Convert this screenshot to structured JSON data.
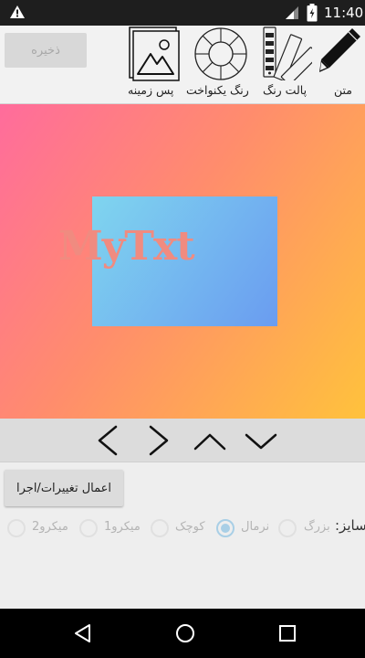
{
  "status_bar": {
    "time": "11:40",
    "icons": [
      "warning-icon",
      "signal-icon",
      "battery-icon"
    ]
  },
  "toolbar": {
    "save_label": "ذخیره",
    "tools": [
      {
        "label": "متن",
        "icon": "pencil-icon"
      },
      {
        "label": "پالت رنگ",
        "icon": "color-palette-icon"
      },
      {
        "label": "رنگ یکنواخت",
        "icon": "color-wheel-icon"
      },
      {
        "label": "پس زمینه",
        "icon": "image-icon"
      }
    ]
  },
  "canvas": {
    "text": "MyTxt",
    "colors": {
      "background_start": "#ff6c9c",
      "background_end": "#ffc23c",
      "rect_start": "#7fd5ef",
      "rect_end": "#6a9cf0",
      "text_color": "#f08b80"
    }
  },
  "arrows": [
    "arrow-left-icon",
    "arrow-right-icon",
    "arrow-up-icon",
    "arrow-down-icon"
  ],
  "apply_label": "اعمال تغییرات/اجرا",
  "size": {
    "label": "سایز:",
    "options": [
      {
        "label": "بزرگ",
        "checked": false
      },
      {
        "label": "نرمال",
        "checked": true
      },
      {
        "label": "کوچک",
        "checked": false
      },
      {
        "label": "میکرو1",
        "checked": false
      },
      {
        "label": "میکرو2",
        "checked": false
      }
    ]
  },
  "nav_bar": [
    "back-icon",
    "home-icon",
    "recents-icon"
  ]
}
